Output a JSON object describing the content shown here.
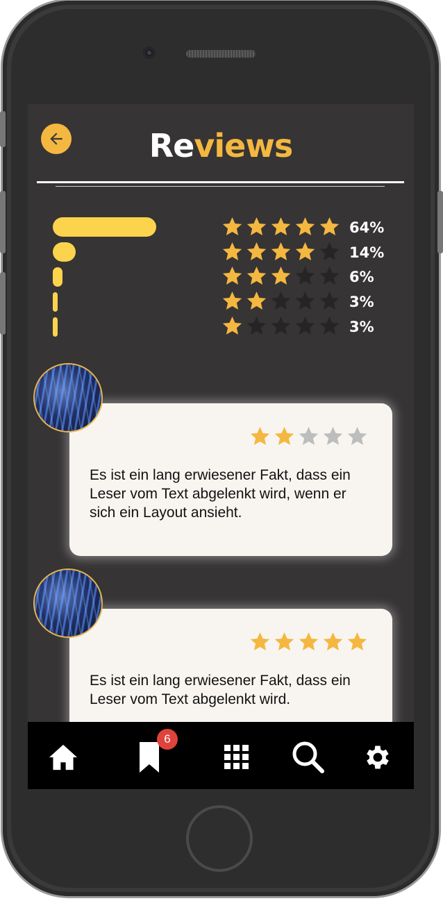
{
  "header": {
    "title_part1": "Re",
    "title_part2": "views",
    "back_icon": "arrow-left-icon"
  },
  "colors": {
    "accent": "#f4b740",
    "bar": "#fcd34d",
    "background": "#363434",
    "card": "#f8f5f0",
    "badge": "#e0433b"
  },
  "rating_summary": [
    {
      "stars": 5,
      "percent": "64%",
      "share": 0.64
    },
    {
      "stars": 4,
      "percent": "14%",
      "share": 0.14
    },
    {
      "stars": 3,
      "percent": "6%",
      "share": 0.06
    },
    {
      "stars": 2,
      "percent": "3%",
      "share": 0.03
    },
    {
      "stars": 1,
      "percent": "3%",
      "share": 0.03
    }
  ],
  "reviews": [
    {
      "rating": 2,
      "text": "Es ist ein lang erwiesener Fakt, dass ein Leser vom Text abgelenkt wird, wenn er sich ein Layout ansieht."
    },
    {
      "rating": 5,
      "text": "Es ist ein lang erwiesener Fakt, dass ein Leser vom Text abgelenkt wird."
    }
  ],
  "navbar": {
    "items": [
      {
        "icon": "home-icon"
      },
      {
        "icon": "bookmark-icon",
        "badge": "6"
      },
      {
        "icon": "grid-icon"
      },
      {
        "icon": "search-icon"
      },
      {
        "icon": "settings-icon"
      }
    ]
  }
}
